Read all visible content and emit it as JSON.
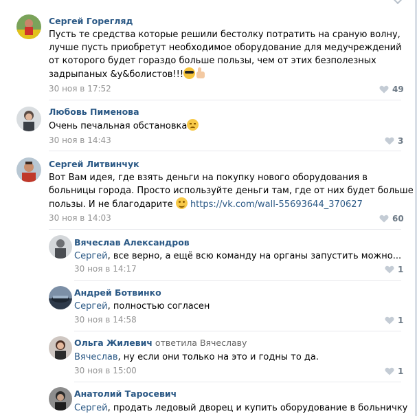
{
  "colors": {
    "link": "#2a5885",
    "muted": "#939393",
    "divider": "#e7e8ec"
  },
  "comments": [
    {
      "author": "Сергей Горегляд",
      "lines": [
        "Пусть те средства которые решили бестолку потратить на сраную волну,",
        "лучше пусть приобретут необходимое оборудование для медучреждений",
        "от которого будет гораздо больше пользы, чем от этих безполезных",
        "задрыпаных &у&болистов!!!"
      ],
      "emojis": [
        "sunglasses-emoji",
        "thumbs-up-emoji"
      ],
      "timestamp": "30 ноя в 17:52",
      "likes": "49"
    },
    {
      "author": "Любовь Пименова",
      "lines": [
        "Очень печальная обстановка"
      ],
      "emojis": [
        "sad-face-emoji"
      ],
      "timestamp": "30 ноя в 14:43",
      "likes": "3"
    },
    {
      "author": "Сергей Литвинчук",
      "lines": [
        "Вот Вам идея, где взять деньги на покупку нового оборудования в",
        "больницы города. Просто используйте деньги там, где от них будет больше",
        "пользы. И не благодарите"
      ],
      "emojis": [
        "smile-emoji"
      ],
      "link": "https://vk.com/wall-55693644_370627",
      "timestamp": "30 ноя в 14:03",
      "likes": "60"
    }
  ],
  "replies": [
    {
      "author": "Вячеслав Александров",
      "mention": "Сергей",
      "text": ", все верно, а ещё всю команду на органы запустить можно...",
      "timestamp": "30 ноя в 14:17",
      "likes": "1"
    },
    {
      "author": "Андрей Ботвинко",
      "mention": "Сергей",
      "text": ", полностью согласен",
      "timestamp": "30 ноя в 14:58",
      "likes": "1"
    },
    {
      "author": "Ольга Жилевич",
      "reply_prefix": " ответила ",
      "reply_to": "Вячеславу",
      "mention": "Вячеслав",
      "text": ", ну если они только на это и годны то да.",
      "timestamp": "30 ноя в 15:00",
      "likes": "1"
    },
    {
      "author": "Анатолий Таросевич",
      "mention": "Сергей",
      "text": ", продать ледовый дворец и купить оборудование в больничку"
    }
  ]
}
